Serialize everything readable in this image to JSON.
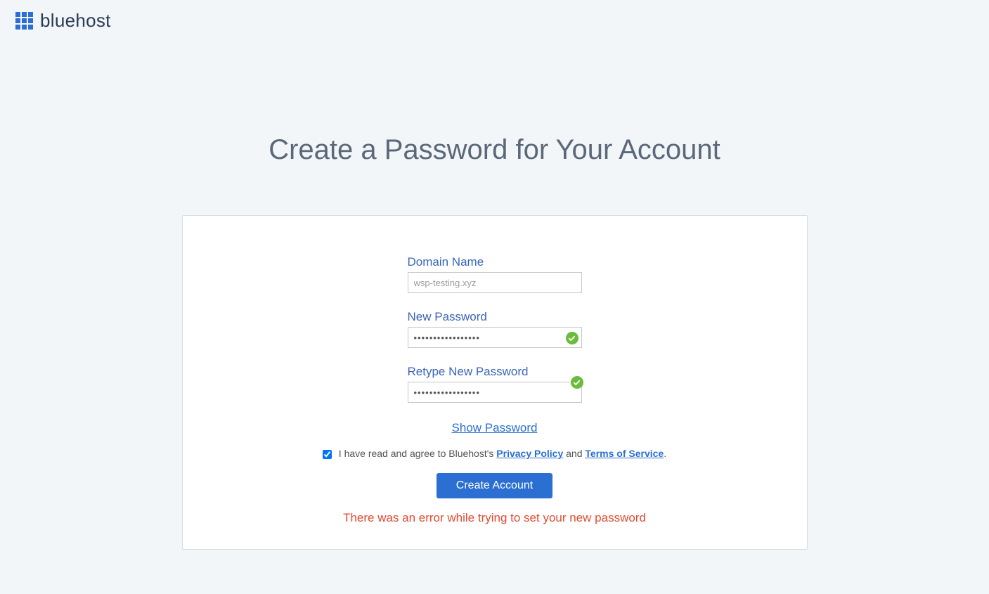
{
  "brand": {
    "name": "bluehost"
  },
  "page": {
    "title": "Create a Password for Your Account"
  },
  "form": {
    "domain": {
      "label": "Domain Name",
      "value": "wsp-testing.xyz"
    },
    "new_password": {
      "label": "New Password",
      "masked_value": "•••••••••••••••••"
    },
    "retype_password": {
      "label": "Retype New Password",
      "masked_value": "•••••••••••••••••"
    },
    "show_password": "Show Password",
    "agree": {
      "prefix": "I have read and agree to Bluehost's ",
      "privacy": "Privacy Policy",
      "mid": " and ",
      "terms": "Terms of Service",
      "suffix": ".",
      "checked": true
    },
    "submit": "Create Account",
    "error": "There was an error while trying to set your new password"
  },
  "colors": {
    "brand_blue": "#2a6fd1",
    "heading_gray": "#5a6878",
    "error_red": "#e24b32",
    "success_green": "#6bbb3d"
  }
}
